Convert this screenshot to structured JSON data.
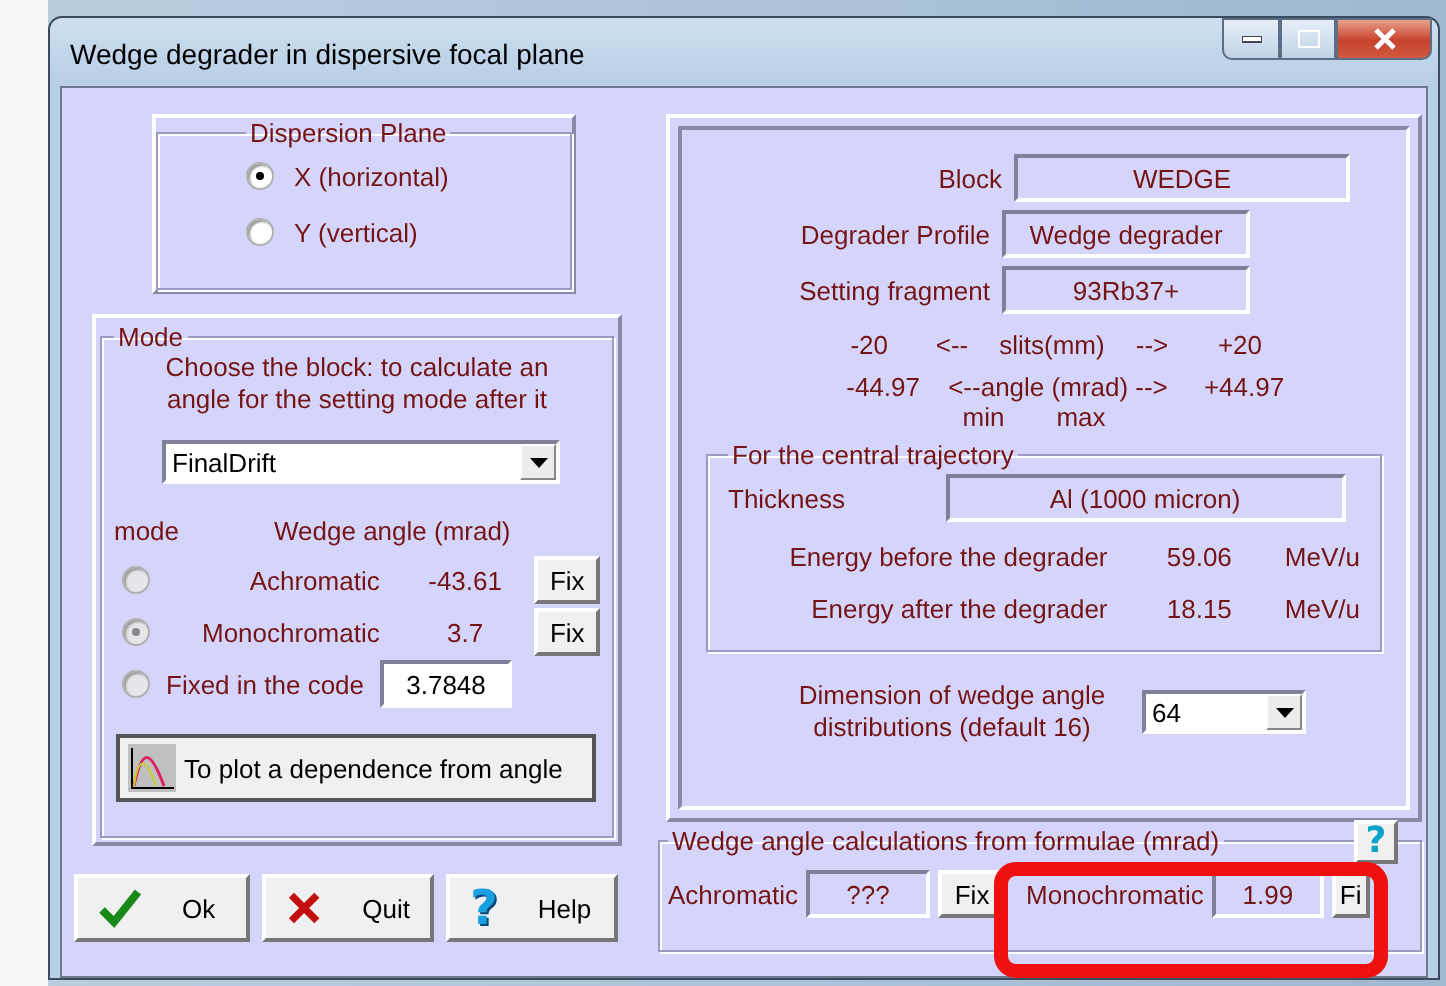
{
  "window": {
    "title": "Wedge degrader  in  dispersive focal plane"
  },
  "dispersion_plane": {
    "title": "Dispersion Plane",
    "options": [
      {
        "label": "X (horizontal)",
        "selected": true
      },
      {
        "label": "Y (vertical)",
        "selected": false
      }
    ]
  },
  "mode": {
    "title": "Mode",
    "instruction": "Choose the block: to calculate an angle for the setting mode after it",
    "block_select": {
      "value": "FinalDrift"
    },
    "column_1": "mode",
    "column_2": "Wedge angle (mrad)",
    "options": [
      {
        "kind": "computed",
        "label": "Achromatic",
        "value": "-43.61",
        "button": "Fix",
        "selected": false
      },
      {
        "kind": "computed",
        "label": "Monochromatic",
        "value": "3.7",
        "button": "Fix",
        "selected": true
      },
      {
        "kind": "input",
        "label": "Fixed in the code",
        "value": "3.7848",
        "selected": false
      }
    ],
    "plot_button": "To plot a dependence from angle"
  },
  "buttons": [
    {
      "kind": "ok",
      "label": "Ok"
    },
    {
      "kind": "quit",
      "label": "Quit"
    },
    {
      "kind": "help",
      "label": "Help",
      "glyph": "?"
    }
  ],
  "info": {
    "fields": [
      {
        "label": "Block",
        "value": "WEDGE"
      },
      {
        "label": "Degrader Profile",
        "value": "Wedge degrader"
      },
      {
        "label": "Setting fragment",
        "value": "93Rb37+"
      }
    ],
    "slits": {
      "min": "-20",
      "left_arrow": "<--",
      "label": "slits(mm)",
      "right_arrow": "-->",
      "max": "+20"
    },
    "angle": {
      "min": "-44.97",
      "label": "<--angle (mrad) -->",
      "max": "+44.97"
    },
    "min_label": "min",
    "max_label": "max",
    "central_trajectory": {
      "title": "For the central trajectory",
      "thickness_label": "Thickness",
      "thickness": "Al (1000 micron)",
      "energies": [
        {
          "label": "Energy before the degrader",
          "value": "59.06",
          "unit": "MeV/u"
        },
        {
          "label": "Energy after the degrader",
          "value": "18.15",
          "unit": "MeV/u"
        }
      ]
    },
    "distributions": {
      "label": "Dimension of wedge angle distributions  (default 16)",
      "value": "64"
    }
  },
  "formulae": {
    "title": "Wedge angle calculations from formulae (mrad)",
    "help_glyph": "?",
    "items": [
      {
        "label": "Achromatic",
        "value": "???",
        "button": "Fix"
      },
      {
        "label": "Monochromatic",
        "value": "1.99",
        "button": "Fi"
      }
    ]
  }
}
